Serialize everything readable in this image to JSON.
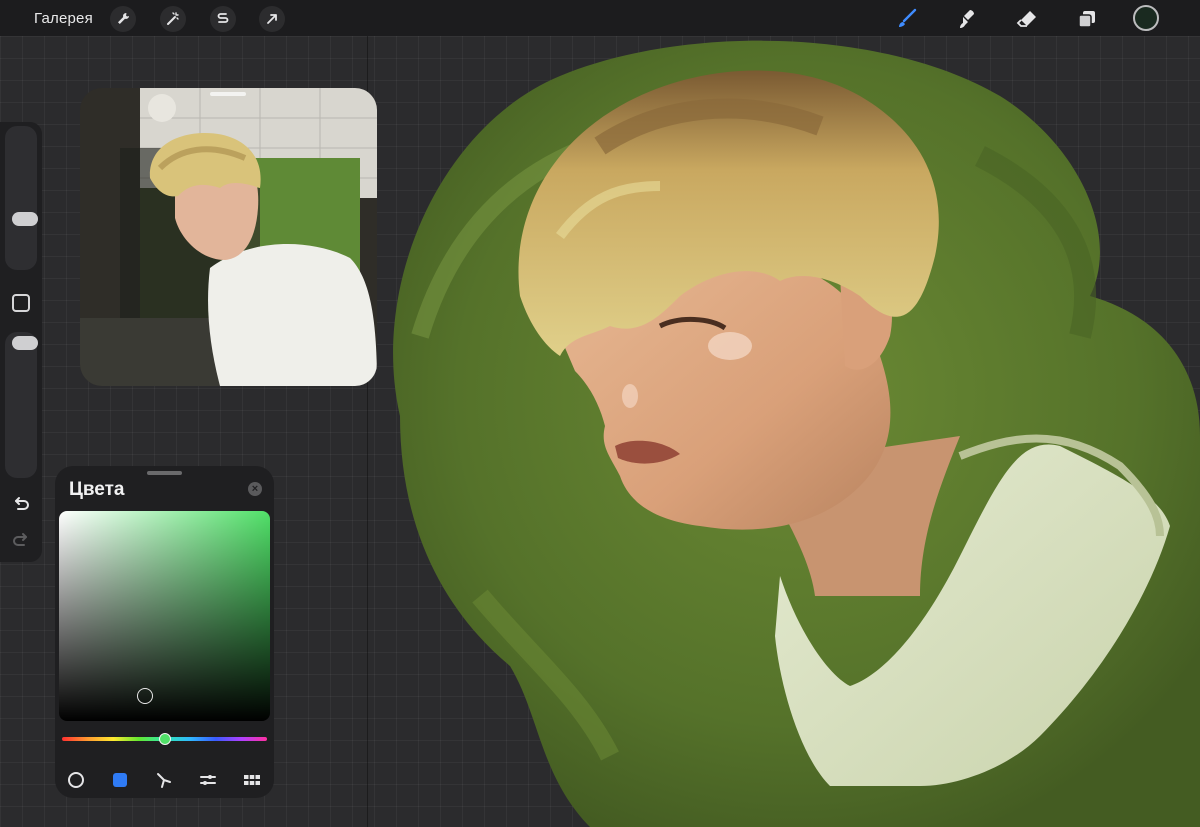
{
  "toolbar": {
    "gallery_label": "Галерея",
    "left_tools": [
      "wrench-icon",
      "magic-wand-icon",
      "selection-icon",
      "transform-arrow-icon"
    ],
    "right_tools": [
      "brush-icon",
      "smudge-icon",
      "eraser-icon",
      "layers-icon"
    ],
    "active_tool": "brush-icon",
    "active_color": "#1a2a20"
  },
  "sidebar": {
    "brush_size": 0.63,
    "brush_opacity": 1.0,
    "controls": [
      "modify-square-icon",
      "undo-icon",
      "redo-icon"
    ]
  },
  "color_panel": {
    "title": "Цвета",
    "current_hue_color": "#50e068",
    "modes": [
      "disc-mode-icon",
      "classic-mode-icon",
      "harmony-mode-icon",
      "value-mode-icon",
      "palettes-mode-icon"
    ],
    "active_mode": "classic-mode-icon"
  },
  "colors": {
    "accent_blue": "#2f7bf5",
    "canvas_green": "#5f7a2e"
  }
}
